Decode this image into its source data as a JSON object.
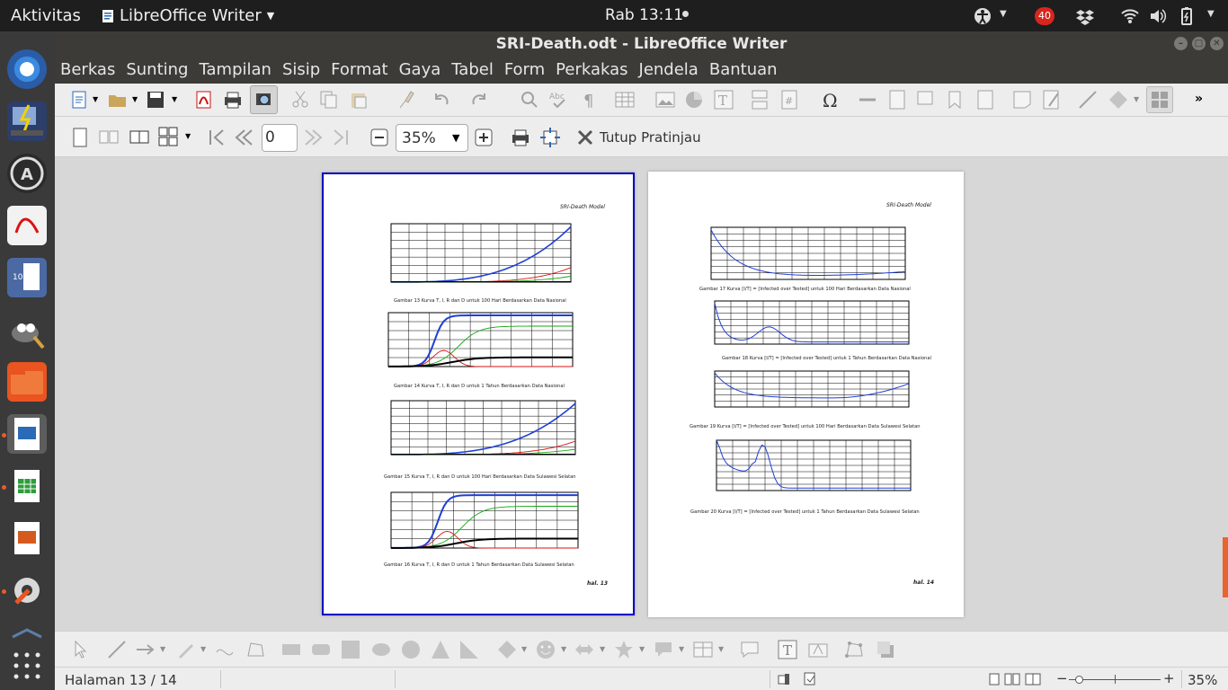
{
  "topbar": {
    "activities": "Aktivitas",
    "app_name": "LibreOffice Writer",
    "clock": "Rab 13:11",
    "notification_count": "40"
  },
  "window": {
    "title": "SRI-Death.odt - LibreOffice Writer"
  },
  "menu": [
    "Berkas",
    "Sunting",
    "Tampilan",
    "Sisip",
    "Format",
    "Gaya",
    "Tabel",
    "Form",
    "Perkakas",
    "Jendela",
    "Bantuan"
  ],
  "preview_toolbar": {
    "page_input": "0",
    "zoom": "35%",
    "close_preview": "Tutup Pratinjau"
  },
  "page13": {
    "header": "SRI-Death Model",
    "footer": "hal. 13",
    "captions": [
      "Gambar 13 Kurva T, I, R dan D untuk 100 Hari Berdasarkan Data Nasional",
      "Gambar 14 Kurva T, I, R dan D untuk 1 Tahun Berdasarkan Data Nasional",
      "Gambar 15 Kurva T, I, R dan D untuk 100 Hari Berdasarkan Data Sulawesi Selatan",
      "Gambar 16 Kurva T, I, R dan D untuk 1 Tahun Berdasarkan Data Sulawesi Selatan"
    ]
  },
  "page14": {
    "header": "SRI-Death Model",
    "footer": "hal. 14",
    "captions": [
      "Gambar 17 Kurva [I/T] = [Infected over Tested] untuk 100 Hari Berdasarkan Data Nasional",
      "Gambar 18 Kurva [I/T] = [Infected over Tested] untuk 1 Tahun Berdasarkan Data Nasional",
      "Gambar 19 Kurva [I/T] = [Infected over Tested] untuk 100 Hari Berdasarkan Data Sulawesi Selatan",
      "Gambar 20 Kurva [I/T] = [Infected over Tested] untuk 1 Tahun Berdasarkan Data Sulawesi Selatan"
    ]
  },
  "statusbar": {
    "page": "Halaman 13 / 14",
    "zoom": "35%"
  },
  "colors": {
    "accent": "#e95420",
    "selection_border": "#0000c0",
    "dock_bg": "#3a3a3a"
  }
}
